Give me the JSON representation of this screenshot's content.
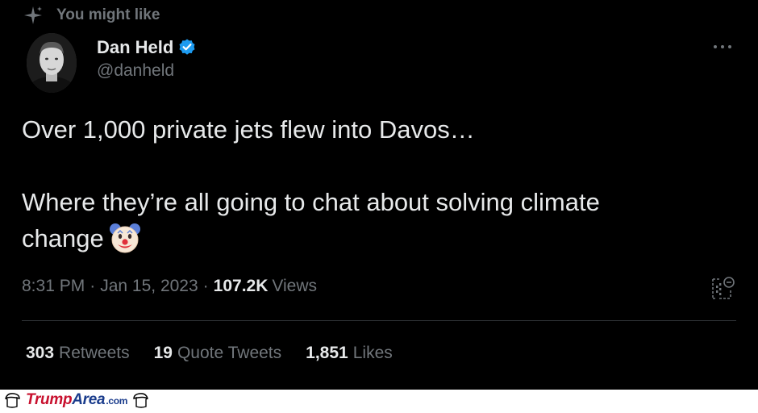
{
  "context": {
    "label": "You might like",
    "icon": "sparkle-icon"
  },
  "author": {
    "display_name": "Dan Held",
    "handle": "@danheld",
    "verified": true,
    "verified_color": "#1d9bf0"
  },
  "tweet": {
    "line1": "Over 1,000 private jets flew into Davos…",
    "line2": "Where they’re all going to chat about solving climate",
    "line3": "change",
    "emoji": "clown-face"
  },
  "meta": {
    "time": "8:31 PM",
    "separator": "·",
    "date": "Jan 15, 2023",
    "views_count": "107.2K",
    "views_label": "Views"
  },
  "stats": {
    "retweets_count": "303",
    "retweets_label": "Retweets",
    "quotes_count": "19",
    "quotes_label": "Quote Tweets",
    "likes_count": "1,851",
    "likes_label": "Likes"
  },
  "footer": {
    "brand_part1": "Trump",
    "brand_part2": "Area",
    "brand_part3": ".com"
  },
  "colors": {
    "background": "#000000",
    "text": "#e7e9ea",
    "muted": "#71767b",
    "divider": "#2f3336",
    "brand_red": "#c8102e",
    "brand_blue": "#1a3c8c"
  }
}
